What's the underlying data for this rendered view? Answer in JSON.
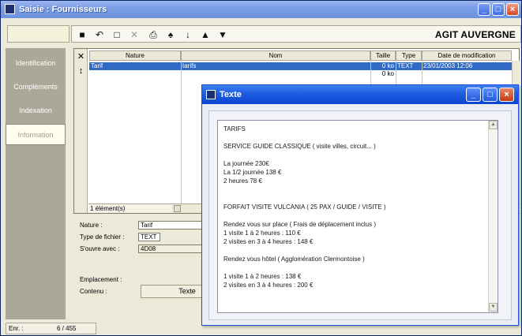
{
  "main_window": {
    "title": "Saisie : Fournisseurs",
    "controls": {
      "minimize": "_",
      "maximize": "□",
      "close": "×"
    }
  },
  "toolbar": {
    "icons": [
      "save-icon",
      "undo-icon",
      "new-doc-icon",
      "delete-icon",
      "print-icon",
      "find-icon",
      "sort-icon",
      "up-arrow-icon",
      "down-arrow-icon"
    ],
    "glyphs": [
      "■",
      "↶",
      "□",
      "✕",
      "⎙",
      "♠",
      "↓",
      "▲",
      "▼"
    ],
    "company": "AGIT AUVERGNE"
  },
  "sidebar": {
    "items": [
      {
        "label": "Identification",
        "active": false
      },
      {
        "label": "Compléments",
        "active": false
      },
      {
        "label": "Indexation",
        "active": false
      },
      {
        "label": "Information",
        "active": true
      }
    ]
  },
  "list": {
    "tools": [
      "✕",
      "↕"
    ],
    "columns": [
      "Nature",
      "Nom",
      "Taille",
      "Type",
      "Date de modification"
    ],
    "rows": [
      {
        "nature": "Tarif",
        "nom": "tarifs",
        "taille": "0 ko",
        "type": "TEXT",
        "date": "23/01/2003 12:06",
        "selected": true
      },
      {
        "nature": "",
        "nom": "",
        "taille": "0 ko",
        "type": "",
        "date": "",
        "selected": false
      }
    ],
    "status": "1 élément(s)"
  },
  "details": {
    "nature_label": "Nature :",
    "nature_value": "Tarif",
    "type_label": "Type de fichier :",
    "type_value": "TEXT",
    "opens_label": "S'ouvre avec :",
    "opens_value": "4D08",
    "location_label": "Emplacement :",
    "content_label": "Contenu :",
    "content_button": "Texte"
  },
  "status_bar": {
    "label": "Enr. :",
    "value": "6 / 455"
  },
  "texte_window": {
    "title": "Texte",
    "controls": {
      "minimize": "_",
      "maximize": "□",
      "close": "×"
    },
    "content": "TARIFS\n\nSERVICE GUIDE CLASSIQUE ( visite villes, circuit... )\n\nLa journée 230€\nLa 1/2 journée 138 €\n2 heures 78 €\n\n\nFORFAIT VISITE VULCANIA ( 25 PAX / GUIDE / VISITE )\n\nRendez vous sur place ( Frais de déplacement inclus )\n1 visite 1 à 2 heures : 110 €\n2 visites en 3 à 4 heures : 148 €\n\nRendez vous hôtel ( Agglomération Clermontoise )\n\n1 visite 1 à 2 heures : 138 €\n2 visites en 3 à 4 heures : 200 €"
  }
}
